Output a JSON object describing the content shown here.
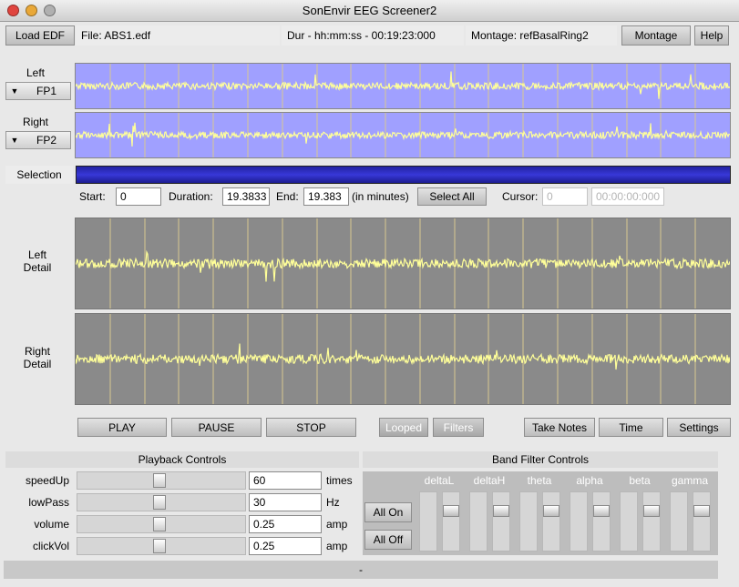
{
  "window": {
    "title": "SonEnvir EEG Screener2"
  },
  "header": {
    "load_label": "Load EDF",
    "file_text": "File:  ABS1.edf",
    "duration_text": "Dur - hh:mm:ss - 00:19:23:000",
    "montage_text": "Montage:  refBasalRing2",
    "montage_button": "Montage",
    "help_button": "Help"
  },
  "overview": {
    "left_label": "Left",
    "left_channel": "FP1",
    "right_label": "Right",
    "right_channel": "FP2",
    "popup_arrow": "▼"
  },
  "selection": {
    "label": "Selection",
    "start_label": "Start:",
    "start_value": "0",
    "duration_label": "Duration:",
    "duration_value": "19.3833",
    "end_label": "End:",
    "end_value": "19.383",
    "units": "(in minutes)",
    "select_all": "Select All",
    "cursor_label": "Cursor:",
    "cursor_value": "0",
    "cursor_time": "00:00:00:000"
  },
  "detail": {
    "left": "Left\nDetail",
    "right": "Right\nDetail"
  },
  "transport": {
    "play": "PLAY",
    "pause": "PAUSE",
    "stop": "STOP",
    "looped": "Looped",
    "filters": "Filters",
    "take_notes": "Take Notes",
    "time": "Time",
    "settings": "Settings"
  },
  "playback": {
    "title": "Playback Controls",
    "rows": [
      {
        "name": "speedUp",
        "value": "60",
        "unit": "times"
      },
      {
        "name": "lowPass",
        "value": "30",
        "unit": "Hz"
      },
      {
        "name": "volume",
        "value": "0.25",
        "unit": "amp"
      },
      {
        "name": "clickVol",
        "value": "0.25",
        "unit": "amp"
      }
    ]
  },
  "bands": {
    "title": "Band Filter Controls",
    "all_on": "All On",
    "all_off": "All Off",
    "names": [
      "deltaL",
      "deltaH",
      "theta",
      "alpha",
      "beta",
      "gamma"
    ]
  },
  "status": {
    "text": "-"
  },
  "colors": {
    "overview_bg": "#a0a0ff",
    "detail_bg": "#8a8a8a",
    "signal": "#ffff99",
    "gridline": "#d8c890",
    "selection": "#2c2cc0"
  }
}
